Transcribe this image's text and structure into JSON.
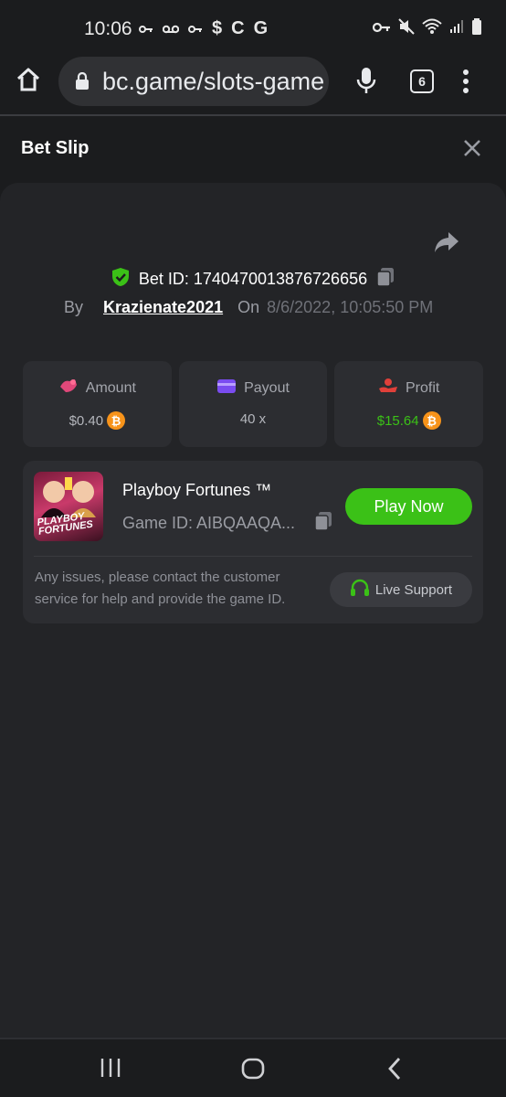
{
  "status": {
    "time": "10:06",
    "left_icons": [
      "key-icon",
      "voicemail-icon",
      "key-icon",
      "dollar-icon",
      "c-icon",
      "g-icon"
    ],
    "right_icons": [
      "vpn-key-icon",
      "mute-icon",
      "wifi-icon",
      "signal-icon",
      "battery-icon"
    ]
  },
  "browser": {
    "url": "bc.game/slots-game",
    "tab_count": "6"
  },
  "slip": {
    "title": "Bet Slip"
  },
  "bet": {
    "id_label": "Bet ID: 1740470013876726656",
    "by_label": "By",
    "username": "Krazienate2021",
    "on_label": "On",
    "datetime": "8/6/2022, 10:05:50 PM"
  },
  "stats": {
    "amount": {
      "label": "Amount",
      "value": "$0.40"
    },
    "payout": {
      "label": "Payout",
      "value": "40 x"
    },
    "profit": {
      "label": "Profit",
      "value": "$15.64"
    }
  },
  "game": {
    "name": "Playboy Fortunes ™",
    "id_label": "Game ID: AIBQAAQA...",
    "thumb_text": "PLAYBOY FORTUNES",
    "play_label": "Play Now",
    "help_text": "Any issues, please contact the customer service for help and provide the game ID.",
    "support_label": "Live Support"
  },
  "colors": {
    "accent_green": "#3bc117",
    "coin": "#f7931a",
    "background": "#1b1c1e",
    "panel": "#232427",
    "card": "#2c2d31"
  }
}
